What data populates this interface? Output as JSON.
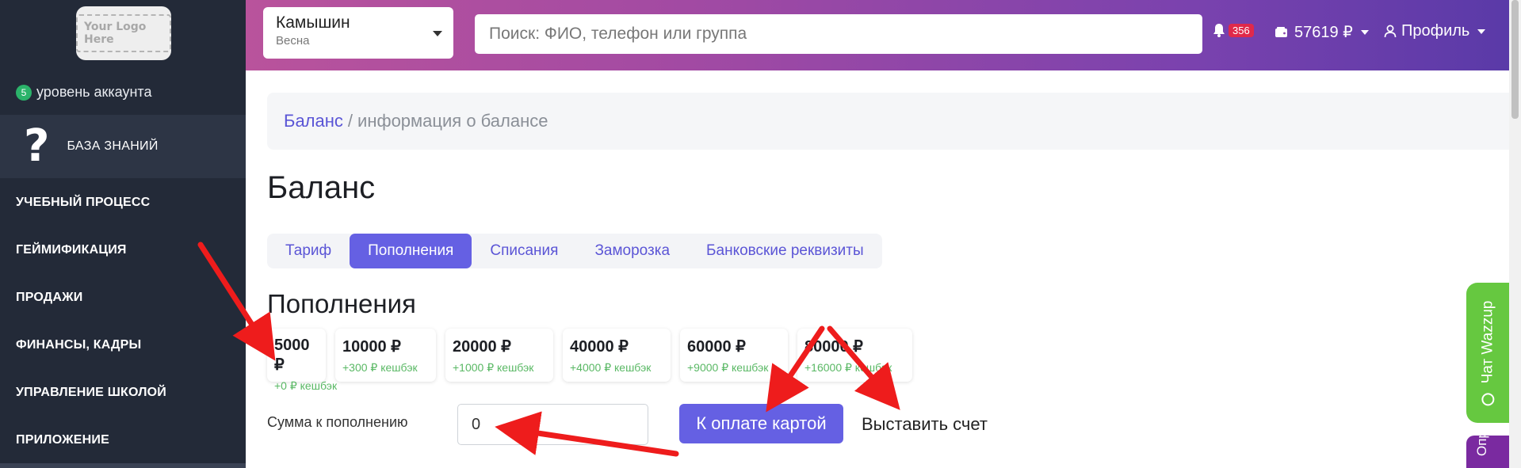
{
  "sidebar": {
    "logo_text": "Your Logo Here",
    "level_count": "5",
    "level_label": "уровень аккаунта",
    "knowledge_base": "БАЗА ЗНАНИЙ",
    "items": [
      {
        "label": "УЧЕБНЫЙ ПРОЦЕСС"
      },
      {
        "label": "ГЕЙМИФИКАЦИЯ"
      },
      {
        "label": "ПРОДАЖИ"
      },
      {
        "label": "ФИНАНСЫ, КАДРЫ"
      },
      {
        "label": "УПРАВЛЕНИЕ ШКОЛОЙ"
      },
      {
        "label": "ПРИЛОЖЕНИЕ"
      }
    ]
  },
  "header": {
    "city_name": "Камышин",
    "city_sub": "Весна",
    "search_placeholder": "Поиск: ФИО, телефон или группа",
    "notifications_count": "356",
    "wallet_amount": "57619 ₽",
    "profile_label": "Профиль"
  },
  "breadcrumb": {
    "link": "Баланс",
    "separator": "/",
    "current": "информация о балансе"
  },
  "page_title": "Баланс",
  "tabs": [
    {
      "label": "Тариф",
      "active": false
    },
    {
      "label": "Пополнения",
      "active": true
    },
    {
      "label": "Списания",
      "active": false
    },
    {
      "label": "Заморозка",
      "active": false
    },
    {
      "label": "Банковские реквизиты",
      "active": false
    }
  ],
  "section_title": "Пополнения",
  "cards": [
    {
      "amount": "5000 ₽",
      "cashback": "+0 ₽ кешбэк"
    },
    {
      "amount": "10000 ₽",
      "cashback": "+300 ₽ кешбэк"
    },
    {
      "amount": "20000 ₽",
      "cashback": "+1000 ₽ кешбэк"
    },
    {
      "amount": "40000 ₽",
      "cashback": "+4000 ₽ кешбэк"
    },
    {
      "amount": "60000 ₽",
      "cashback": "+9000 ₽ кешбэк"
    },
    {
      "amount": "80000 ₽",
      "cashback": "+16000 ₽ кешбэк"
    }
  ],
  "amount_form": {
    "label": "Сумма к пополнению",
    "value": "0",
    "pay_button": "К оплате картой",
    "invoice_link": "Выставить счет"
  },
  "chat_widget": {
    "label": "Чат Wazzup"
  },
  "survey_widget": {
    "label": "Опрос"
  },
  "colors": {
    "sidebar_bg": "#232a38",
    "accent": "#6560e3",
    "cashback_green": "#59b864",
    "chat_green": "#66c840",
    "badge_red": "#e0294a",
    "annotation_red": "#ee1c1c"
  }
}
